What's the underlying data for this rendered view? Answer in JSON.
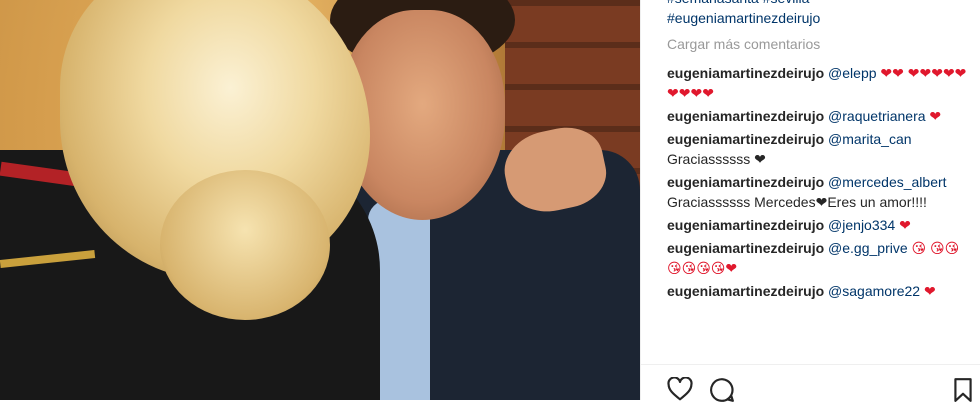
{
  "caption": {
    "hashtags_line1": "#semanasanta #sevilla",
    "hashtags_line2": "#eugeniamartinezdeirujo"
  },
  "load_more": "Cargar más comentarios",
  "comments": [
    {
      "user": "eugeniamartinezdeirujo",
      "mention": "@elepp",
      "text": " ❤❤ ❤❤❤❤❤❤❤❤❤"
    },
    {
      "user": "eugeniamartinezdeirujo",
      "mention": "@raquetrianera",
      "text": " ❤"
    },
    {
      "user": "eugeniamartinezdeirujo",
      "mention": "@marita_can",
      "text": " Graciassssss ❤"
    },
    {
      "user": "eugeniamartinezdeirujo",
      "mention": "@mercedes_albert",
      "text": " Graciassssss Mercedes❤Eres un amor!!!!"
    },
    {
      "user": "eugeniamartinezdeirujo",
      "mention": "@jenjo334",
      "text": " ❤"
    },
    {
      "user": "eugeniamartinezdeirujo",
      "mention": "@e.gg_prive",
      "text": " 😘 😘😘😘😘😘😘❤"
    },
    {
      "user": "eugeniamartinezdeirujo",
      "mention": "@sagamore22",
      "text": " ❤"
    }
  ],
  "icons": {
    "like": "heart-outline-icon",
    "comment": "comment-bubble-icon",
    "save": "bookmark-icon"
  },
  "colors": {
    "link": "#003569",
    "muted": "#999999",
    "heart": "#e0182d",
    "text": "#262626"
  }
}
